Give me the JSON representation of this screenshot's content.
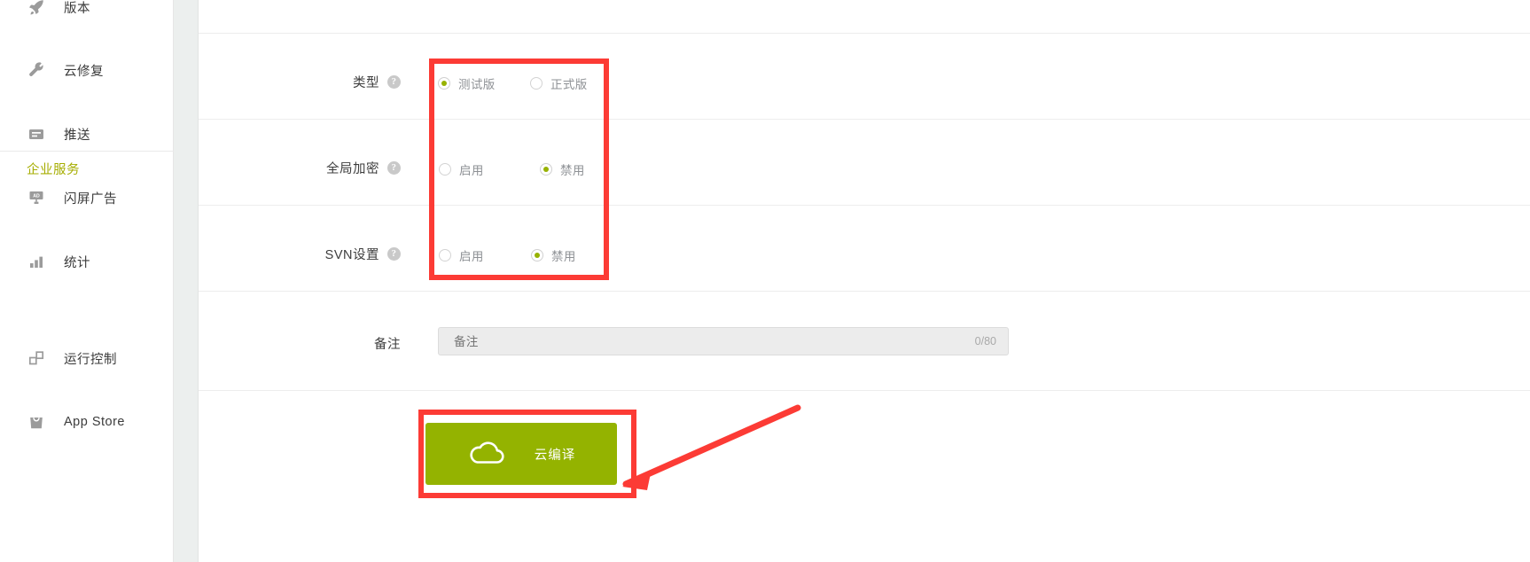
{
  "sidebar": {
    "items": [
      {
        "label": "版本",
        "icon": "rocket-icon"
      },
      {
        "label": "云修复",
        "icon": "wrench-icon"
      },
      {
        "label": "推送",
        "icon": "push-message-icon"
      },
      {
        "label": "闪屏广告",
        "icon": "ad-banner-icon"
      },
      {
        "label": "统计",
        "icon": "bar-chart-icon"
      }
    ],
    "group_title": "企业服务",
    "group_items": [
      {
        "label": "运行控制",
        "icon": "run-control-icon"
      },
      {
        "label": "App Store",
        "icon": "app-store-bag-icon"
      }
    ]
  },
  "form": {
    "rows": [
      {
        "label": "类型",
        "help": "?",
        "options": [
          {
            "label": "测试版",
            "selected": true
          },
          {
            "label": "正式版",
            "selected": false
          }
        ]
      },
      {
        "label": "全局加密",
        "help": "?",
        "options": [
          {
            "label": "启用",
            "selected": false
          },
          {
            "label": "禁用",
            "selected": true
          }
        ]
      },
      {
        "label": "SVN设置",
        "help": "?",
        "options": [
          {
            "label": "启用",
            "selected": false
          },
          {
            "label": "禁用",
            "selected": true
          }
        ]
      }
    ],
    "remark": {
      "label": "备注",
      "placeholder": "备注",
      "value": "",
      "counter": "0/80"
    },
    "submit": {
      "label": "云编译",
      "icon": "cloud-icon",
      "color": "#94b300"
    }
  },
  "annotations": {
    "highlight_color": "#fc3b35",
    "boxes": [
      "radio-group-highlight",
      "submit-button-highlight"
    ],
    "arrow": "arrow-pointing-to-submit-button"
  }
}
